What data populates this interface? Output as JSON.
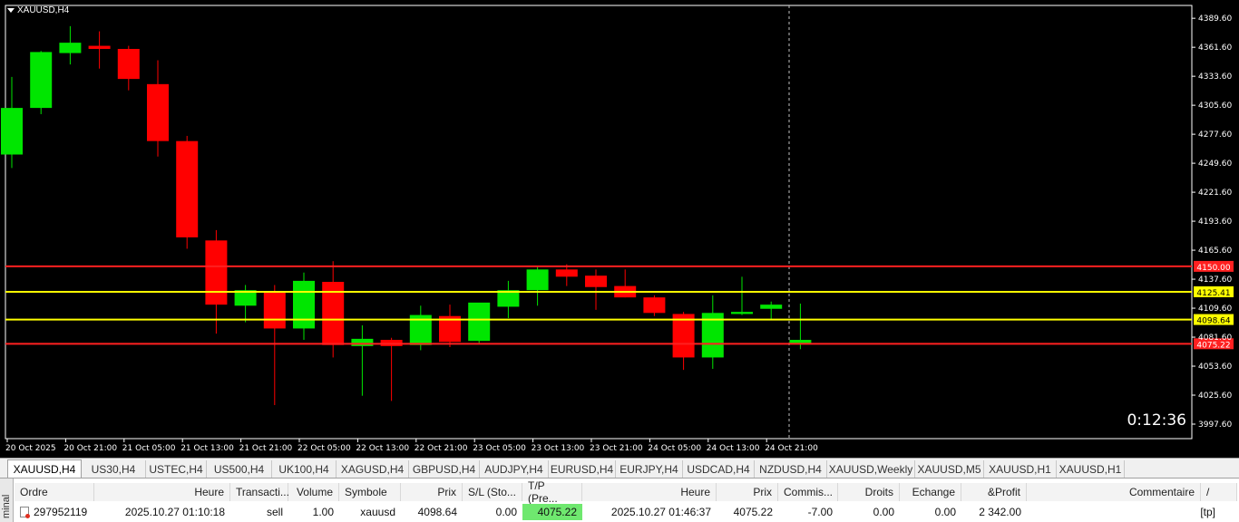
{
  "symbol_title": "XAUUSD,H4",
  "timer": "0:12:36",
  "colors": {
    "bull": "#00e600",
    "bear": "#ff0000",
    "level_red": "#ff2020",
    "level_yellow": "#ffff00"
  },
  "chart_data": {
    "type": "candlestick",
    "symbol": "XAUUSD",
    "timeframe": "H4",
    "ylim": [
      3983.6,
      4402.0
    ],
    "y_ticks": [
      "4389.60",
      "4361.60",
      "4333.60",
      "4305.60",
      "4277.60",
      "4249.60",
      "4221.60",
      "4193.60",
      "4165.60",
      "4137.60",
      "4109.60",
      "4081.60",
      "4053.60",
      "4025.60",
      "3997.60"
    ],
    "x_labels": [
      "20 Oct 2025",
      "20 Oct 21:00",
      "21 Oct 05:00",
      "21 Oct 13:00",
      "21 Oct 21:00",
      "22 Oct 05:00",
      "22 Oct 13:00",
      "22 Oct 21:00",
      "23 Oct 05:00",
      "23 Oct 13:00",
      "23 Oct 21:00",
      "24 Oct 05:00",
      "24 Oct 13:00",
      "24 Oct 21:00"
    ],
    "candles": [
      {
        "o": 4258,
        "h": 4333,
        "l": 4245,
        "c": 4303
      },
      {
        "o": 4303,
        "h": 4358,
        "l": 4297,
        "c": 4357
      },
      {
        "o": 4356,
        "h": 4382,
        "l": 4345,
        "c": 4366
      },
      {
        "o": 4363,
        "h": 4377,
        "l": 4341,
        "c": 4360
      },
      {
        "o": 4360,
        "h": 4363,
        "l": 4320,
        "c": 4331
      },
      {
        "o": 4326,
        "h": 4349,
        "l": 4256,
        "c": 4271
      },
      {
        "o": 4271,
        "h": 4276,
        "l": 4167,
        "c": 4178
      },
      {
        "o": 4175,
        "h": 4185,
        "l": 4085,
        "c": 4113
      },
      {
        "o": 4112,
        "h": 4132,
        "l": 4096,
        "c": 4127
      },
      {
        "o": 4126,
        "h": 4132,
        "l": 4016,
        "c": 4090
      },
      {
        "o": 4090,
        "h": 4144,
        "l": 4079,
        "c": 4136
      },
      {
        "o": 4135,
        "h": 4155,
        "l": 4062,
        "c": 4074
      },
      {
        "o": 4073,
        "h": 4093,
        "l": 4025,
        "c": 4080
      },
      {
        "o": 4079,
        "h": 4081,
        "l": 4020,
        "c": 4073
      },
      {
        "o": 4074,
        "h": 4112,
        "l": 4069,
        "c": 4103
      },
      {
        "o": 4102,
        "h": 4113,
        "l": 4072,
        "c": 4077
      },
      {
        "o": 4078,
        "h": 4114,
        "l": 4076,
        "c": 4115
      },
      {
        "o": 4111,
        "h": 4136,
        "l": 4100,
        "c": 4127
      },
      {
        "o": 4127,
        "h": 4150,
        "l": 4112,
        "c": 4147
      },
      {
        "o": 4147,
        "h": 4152,
        "l": 4131,
        "c": 4140
      },
      {
        "o": 4141,
        "h": 4147,
        "l": 4108,
        "c": 4130
      },
      {
        "o": 4131,
        "h": 4147,
        "l": 4120,
        "c": 4120
      },
      {
        "o": 4120,
        "h": 4122,
        "l": 4102,
        "c": 4105
      },
      {
        "o": 4104,
        "h": 4106,
        "l": 4050,
        "c": 4062
      },
      {
        "o": 4062,
        "h": 4122,
        "l": 4051,
        "c": 4105
      },
      {
        "o": 4104,
        "h": 4140,
        "l": 4103,
        "c": 4106
      },
      {
        "o": 4109,
        "h": 4116,
        "l": 4098,
        "c": 4113
      },
      {
        "o": 4076,
        "h": 4114,
        "l": 4070,
        "c": 4079
      }
    ],
    "levels": [
      {
        "value": 4150.0,
        "label": "4150.00",
        "color": "red"
      },
      {
        "value": 4125.41,
        "label": "4125.41",
        "color": "yellow"
      },
      {
        "value": 4098.64,
        "label": "4098.64",
        "color": "yellow"
      },
      {
        "value": 4075.22,
        "label": "4075.22",
        "color": "red"
      }
    ]
  },
  "tabs": [
    "XAUUSD,H4",
    "US30,H4",
    "USTEC,H4",
    "US500,H4",
    "UK100,H4",
    "XAGUSD,H4",
    "GBPUSD,H4",
    "AUDJPY,H4",
    "EURUSD,H4",
    "EURJPY,H4",
    "USDCAD,H4",
    "NZDUSD,H4",
    "XAUUSD,Weekly",
    "XAUUSD,M5",
    "XAUUSD,H1",
    "XAUUSD,H1"
  ],
  "terminal": {
    "side_label": "minal",
    "headers": [
      "Ordre",
      "Heure",
      "Transacti...",
      "Volume",
      "Symbole",
      "Prix",
      "S/L (Sto...",
      "T/P (Pre...",
      "Heure",
      "Prix",
      "Commis...",
      "Droits",
      "Echange",
      "&Profit",
      "Commentaire",
      "/"
    ],
    "row": [
      "297952119",
      "2025.10.27 01:10:18",
      "sell",
      "1.00",
      "xauusd",
      "4098.64",
      "0.00",
      "4075.22",
      "2025.10.27 01:46:37",
      "4075.22",
      "-7.00",
      "0.00",
      "0.00",
      "2 342.00",
      "[tp]"
    ]
  }
}
